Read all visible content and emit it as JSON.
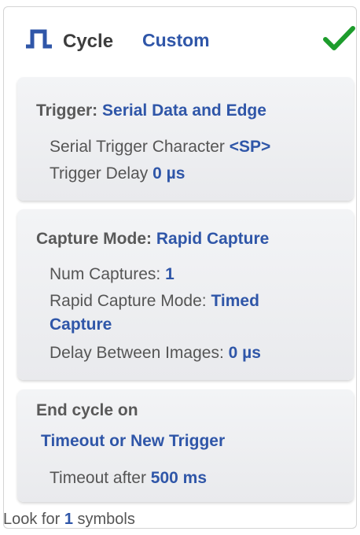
{
  "header": {
    "icon": "square-wave-icon",
    "title": "Cycle",
    "mode": "Custom",
    "confirm_icon": "checkmark-icon",
    "colors": {
      "accent": "#2f56a8",
      "check": "#1d9c2c"
    }
  },
  "trigger": {
    "title_label": "Trigger:",
    "title_value": "Serial Data and Edge",
    "serial_char_label": "Serial Trigger Character",
    "serial_char_value": "<SP>",
    "delay_label": "Trigger Delay",
    "delay_value": "0 µs"
  },
  "capture": {
    "title_label": "Capture Mode:",
    "title_value": "Rapid Capture",
    "num_label": "Num Captures:",
    "num_value": "1",
    "rapid_label": "Rapid Capture Mode:",
    "rapid_value_1": "Timed",
    "rapid_value_2": "Capture",
    "delay_label": "Delay Between Images:",
    "delay_value": "0 µs"
  },
  "end_cycle": {
    "title": "End cycle on",
    "mode": "Timeout or New Trigger",
    "timeout_label": "Timeout after",
    "timeout_value": "500 ms"
  },
  "footer": {
    "prefix": "Look for",
    "count": "1",
    "suffix": "symbols"
  }
}
